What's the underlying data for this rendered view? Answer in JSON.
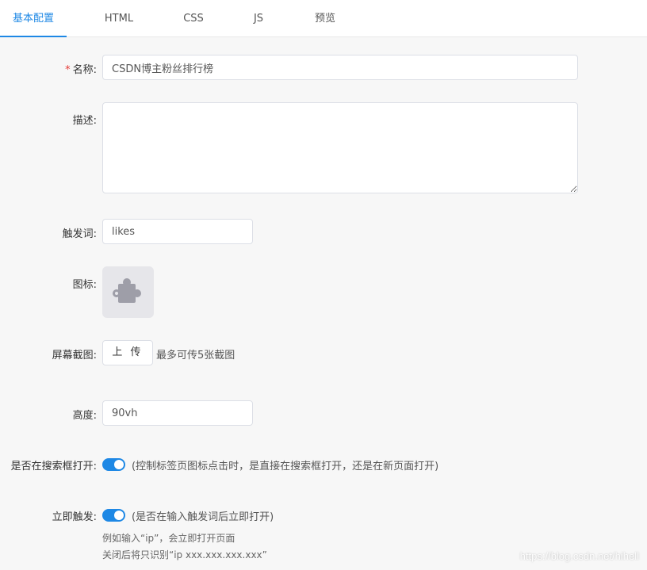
{
  "tabs": [
    "基本配置",
    "HTML",
    "CSS",
    "JS",
    "预览"
  ],
  "form": {
    "name": {
      "required_mark": "*",
      "label": "名称:",
      "value": "CSDN博主粉丝排行榜"
    },
    "description": {
      "label": "描述:",
      "value": ""
    },
    "trigger": {
      "label": "触发词:",
      "value": "likes"
    },
    "icon": {
      "label": "图标:",
      "icon_name": "puzzle-piece-icon"
    },
    "screenshots": {
      "label": "屏幕截图:",
      "upload_label": "上 传",
      "hint": "最多可传5张截图"
    },
    "height": {
      "label": "高度:",
      "value": "90vh"
    },
    "open_in_search": {
      "label": "是否在搜索框打开:",
      "enabled": true,
      "hint": "(控制标签页图标点击时，是直接在搜索框打开，还是在新页面打开)"
    },
    "instant_trigger": {
      "label": "立即触发:",
      "enabled": true,
      "hint": "(是否在输入触发词后立即打开)",
      "notes": [
        "例如输入“ip”，会立即打开页面",
        "关闭后将只识别“ip xxx.xxx.xxx.xxx”"
      ]
    }
  },
  "watermark": "https://blog.csdn.net/hihell",
  "colors": {
    "accent": "#1e88e5",
    "required": "#e53935",
    "background": "#f7f7f7"
  }
}
